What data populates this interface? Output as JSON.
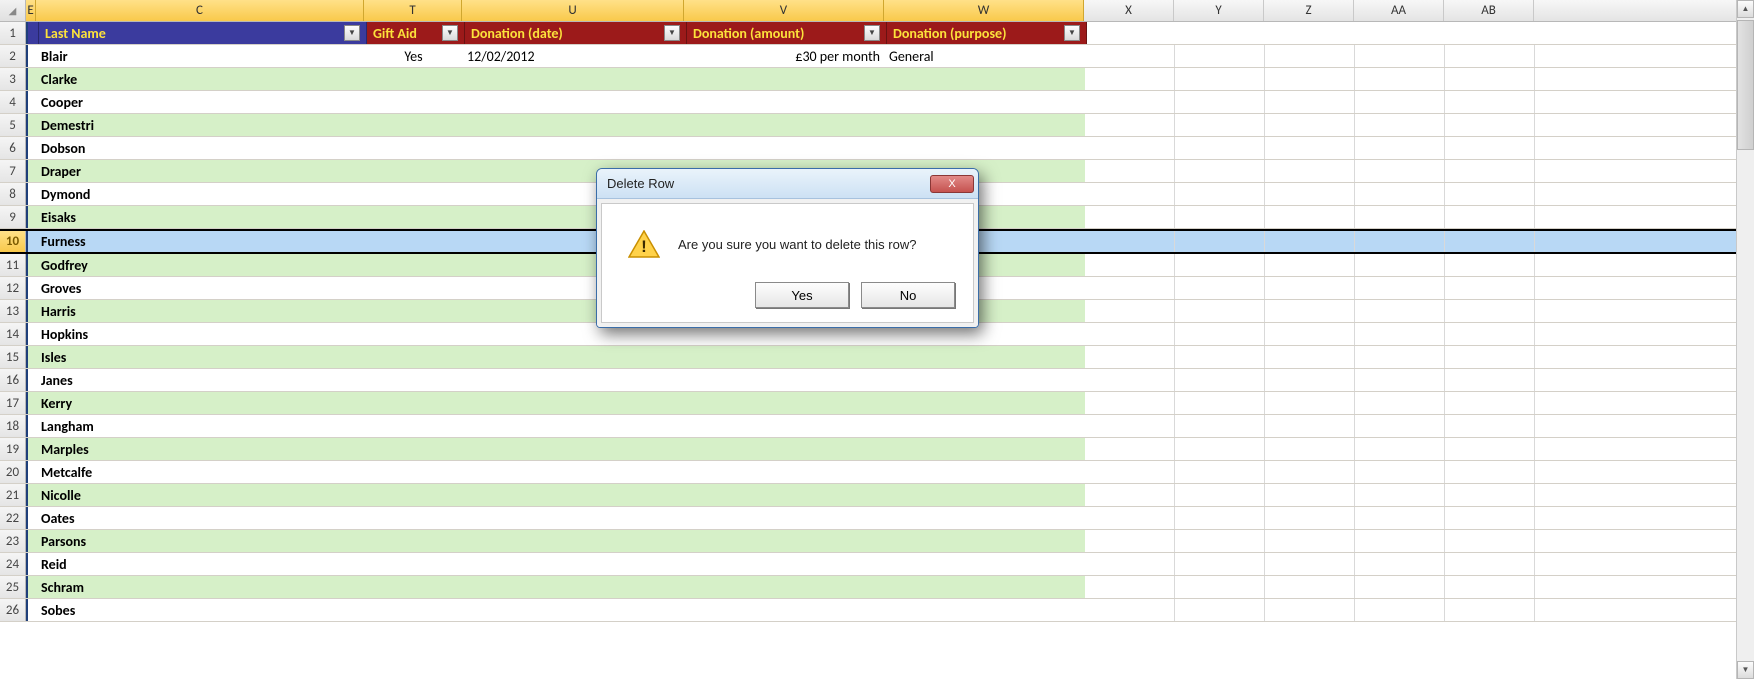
{
  "columns": {
    "B": "E",
    "C": "C",
    "T": "T",
    "U": "U",
    "V": "V",
    "W": "W",
    "X": "X",
    "Y": "Y",
    "Z": "Z",
    "AA": "AA",
    "AB": "AB"
  },
  "headers": {
    "lastName": "Last Name",
    "giftAid": "Gift Aid",
    "donationDate": "Donation (date)",
    "donationAmount": "Donation (amount)",
    "donationPurpose": "Donation (purpose)"
  },
  "rows": [
    {
      "n": 2,
      "last": "Blair",
      "gift": "Yes",
      "date": "12/02/2012",
      "amount": "£30 per month",
      "purpose": "General"
    },
    {
      "n": 3,
      "last": "Clarke"
    },
    {
      "n": 4,
      "last": "Cooper"
    },
    {
      "n": 5,
      "last": "Demestri"
    },
    {
      "n": 6,
      "last": "Dobson"
    },
    {
      "n": 7,
      "last": "Draper"
    },
    {
      "n": 8,
      "last": "Dymond"
    },
    {
      "n": 9,
      "last": "Eisaks"
    },
    {
      "n": 10,
      "last": "Furness",
      "selected": true
    },
    {
      "n": 11,
      "last": "Godfrey"
    },
    {
      "n": 12,
      "last": "Groves"
    },
    {
      "n": 13,
      "last": "Harris"
    },
    {
      "n": 14,
      "last": "Hopkins"
    },
    {
      "n": 15,
      "last": "Isles"
    },
    {
      "n": 16,
      "last": "Janes"
    },
    {
      "n": 17,
      "last": "Kerry"
    },
    {
      "n": 18,
      "last": "Langham"
    },
    {
      "n": 19,
      "last": "Marples"
    },
    {
      "n": 20,
      "last": "Metcalfe"
    },
    {
      "n": 21,
      "last": "Nicolle"
    },
    {
      "n": 22,
      "last": "Oates"
    },
    {
      "n": 23,
      "last": "Parsons"
    },
    {
      "n": 24,
      "last": "Reid"
    },
    {
      "n": 25,
      "last": "Schram"
    },
    {
      "n": 26,
      "last": "Sobes"
    }
  ],
  "dialog": {
    "title": "Delete Row",
    "message": "Are you sure you want to delete this row?",
    "yes": "Yes",
    "no": "No",
    "closeX": "X"
  }
}
